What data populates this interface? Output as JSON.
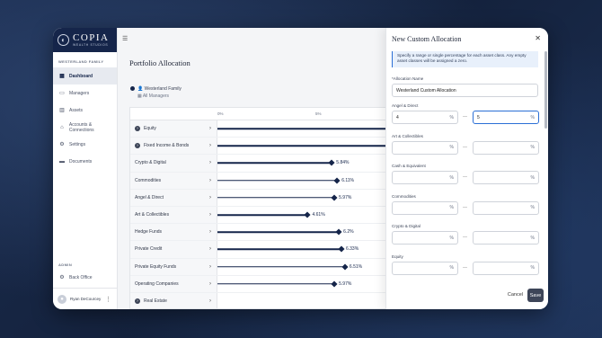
{
  "brand": {
    "name": "COPIA",
    "tagline": "WEALTH STUDIOS"
  },
  "sidebar": {
    "section_label": "WESTERLAND FAMILY",
    "items": [
      {
        "label": "Dashboard",
        "icon": "grid-icon",
        "active": true
      },
      {
        "label": "Managers",
        "icon": "id-card-icon"
      },
      {
        "label": "Assets",
        "icon": "bar-chart-icon"
      },
      {
        "label": "Accounts & Connections",
        "icon": "bank-icon"
      },
      {
        "label": "Settings",
        "icon": "gear-icon"
      },
      {
        "label": "Documents",
        "icon": "folder-icon"
      }
    ],
    "admin_label": "ADMIN",
    "admin_items": [
      {
        "label": "Back Office",
        "icon": "gear-icon"
      }
    ],
    "user_name": "Ryan DeCourcey"
  },
  "main": {
    "title": "Portfolio Allocation",
    "owner": "Westerland Family",
    "owner_sub": "All Managers",
    "axis": {
      "t0": "0%",
      "t5": "5%"
    }
  },
  "chart_data": {
    "type": "bar",
    "categories": [
      "Equity",
      "Fixed Income & Bonds",
      "Crypto & Digital",
      "Commodities",
      "Angel & Direct",
      "Art & Collectibles",
      "Hedge Funds",
      "Private Credit",
      "Private Equity Funds",
      "Operating Companies",
      "Real Estate"
    ],
    "values": [
      null,
      null,
      5.84,
      6.11,
      5.97,
      4.61,
      6.2,
      6.33,
      6.51,
      5.97,
      null
    ],
    "labels": [
      "",
      "",
      "5.84%",
      "6.11%",
      "5.97%",
      "4.61%",
      "6.2%",
      "6.33%",
      "6.51%",
      "5.97%",
      ""
    ],
    "expandable": [
      true,
      true,
      false,
      false,
      false,
      false,
      false,
      false,
      false,
      false,
      true
    ],
    "xlim": [
      0,
      8
    ]
  },
  "modal": {
    "title": "New Custom Allocation",
    "info": "Specify a range or single percentage for each asset class. Any empty asset classes will be assigned a zero.",
    "name_label": "*Allocation Name",
    "name_value": "Westerland Custom Allocation",
    "fields": [
      {
        "label": "Angel & Direct",
        "min": "4",
        "max": "5"
      },
      {
        "label": "Art & Collectibles",
        "min": "",
        "max": ""
      },
      {
        "label": "Cash & Equivalent",
        "min": "",
        "max": ""
      },
      {
        "label": "Commodities",
        "min": "",
        "max": ""
      },
      {
        "label": "Crypto & Digital",
        "min": "",
        "max": ""
      },
      {
        "label": "Equity",
        "min": "",
        "max": ""
      }
    ],
    "pct": "%",
    "cancel": "Cancel",
    "save": "Save",
    "close_glyph": "✕"
  }
}
